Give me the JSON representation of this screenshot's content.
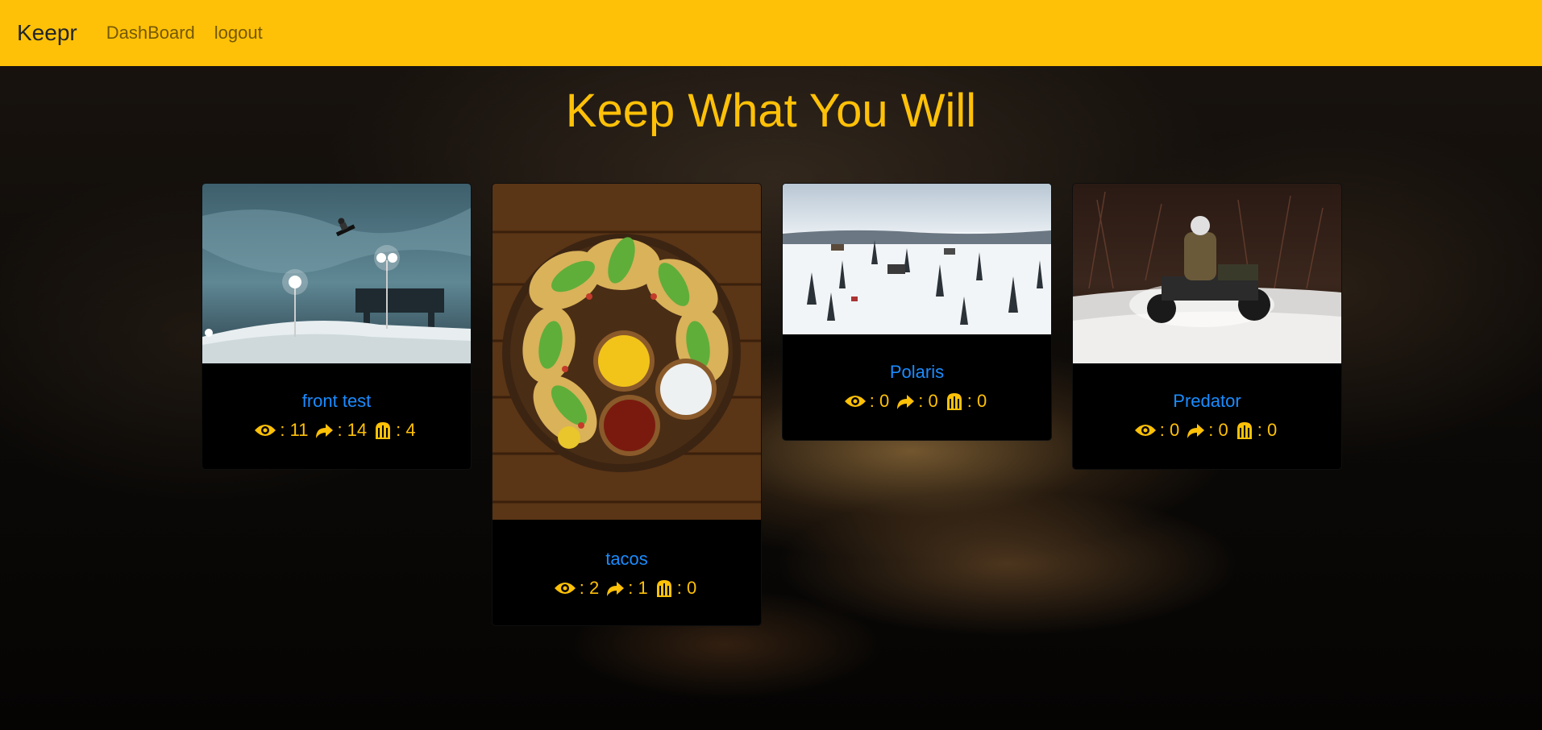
{
  "navbar": {
    "brand": "Keepr",
    "links": [
      "DashBoard",
      "logout"
    ]
  },
  "headline": "Keep What You Will",
  "colors": {
    "accent": "#ffc107",
    "link": "#1a8cff",
    "card_bg": "#000000"
  },
  "icons": {
    "views": "eye-icon",
    "shares": "share-icon",
    "keeps": "vault-icon"
  },
  "keeps": [
    {
      "name": "front test",
      "views": ": 11",
      "shares": ": 14",
      "keeps": ": 4"
    },
    {
      "name": "tacos",
      "views": ": 2",
      "shares": ": 1",
      "keeps": ": 0"
    },
    {
      "name": "Polaris",
      "views": ": 0",
      "shares": ": 0",
      "keeps": ": 0"
    },
    {
      "name": "Predator",
      "views": ": 0",
      "shares": ": 0",
      "keeps": ": 0"
    }
  ]
}
